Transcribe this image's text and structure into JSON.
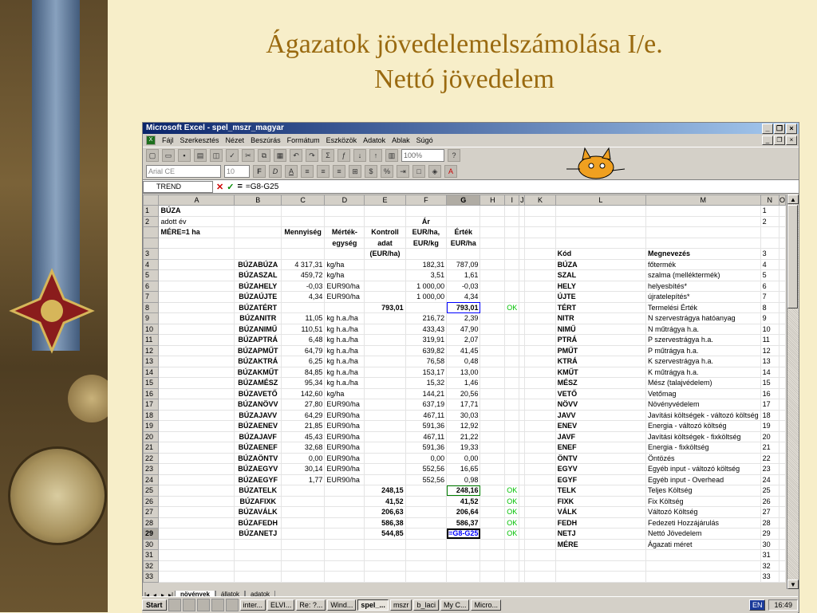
{
  "slide": {
    "title_line1": "Ágazatok jövedelemelszámolása I/e.",
    "title_line2": "Nettó jövedelem"
  },
  "excel": {
    "window_title": "Microsoft Excel - spel_mszr_magyar",
    "menu": [
      "Fájl",
      "Szerkesztés",
      "Nézet",
      "Beszúrás",
      "Formátum",
      "Eszközök",
      "Adatok",
      "Ablak",
      "Súgó"
    ],
    "zoom": "100%",
    "font_name": "Arial CE",
    "font_size": "10",
    "name_box": "TREND",
    "formula": "=G8-G25",
    "columns": [
      "A",
      "B",
      "C",
      "D",
      "E",
      "F",
      "G",
      "H",
      "I",
      "J",
      "K",
      "L",
      "M",
      "N",
      "O"
    ],
    "rows": [
      {
        "n": "1",
        "a": "BÚZA"
      },
      {
        "n": "2",
        "a": "adott év",
        "f": "Ár"
      },
      {
        "n": "",
        "a": "MÉRE=1 ha",
        "c": "Mennyiség",
        "d": "Mérték-",
        "e": "Kontroll",
        "f": "EUR/ha,",
        "g": "Érték"
      },
      {
        "n": "",
        "d": "egység",
        "e": "adat",
        "f": "EUR/kg",
        "g": "EUR/ha"
      },
      {
        "n": "3",
        "e": "(EUR/ha)",
        "l": "Kód",
        "m": "Megnevezés"
      },
      {
        "n": "4",
        "b": "BÚZABÚZA",
        "c": "4 317,31",
        "d": "kg/ha",
        "f": "182,31",
        "g": "787,09",
        "l": "BÚZA",
        "m": "főtermék"
      },
      {
        "n": "5",
        "b": "BÚZASZAL",
        "c": "459,72",
        "d": "kg/ha",
        "f": "3,51",
        "g": "1,61",
        "l": "SZAL",
        "m": "szalma (melléktermék)"
      },
      {
        "n": "6",
        "b": "BÚZAHELY",
        "c": "-0,03",
        "d": "EUR90/ha",
        "f": "1 000,00",
        "g": "-0,03",
        "l": "HELY",
        "m": "helyesbítés*"
      },
      {
        "n": "7",
        "b": "BÚZAÚJTE",
        "c": "4,34",
        "d": "EUR90/ha",
        "f": "1 000,00",
        "g": "4,34",
        "l": "ÚJTE",
        "m": "újratelepítés*"
      },
      {
        "n": "8",
        "b": "BÚZATÉRT",
        "e": "793,01",
        "g": "793,01",
        "i": "OK",
        "l": "TÉRT",
        "m": "Termelési Érték"
      },
      {
        "n": "9",
        "b": "BÚZANITR",
        "c": "11,05",
        "d": "kg h.a./ha",
        "f": "216,72",
        "g": "2,39",
        "l": "NITR",
        "m": "N szervestrágya hatóanyag"
      },
      {
        "n": "10",
        "b": "BÚZANIMŰ",
        "c": "110,51",
        "d": "kg h.a./ha",
        "f": "433,43",
        "g": "47,90",
        "l": "NIMŰ",
        "m": "N műtrágya h.a."
      },
      {
        "n": "11",
        "b": "BÚZAPTRÁ",
        "c": "6,48",
        "d": "kg h.a./ha",
        "f": "319,91",
        "g": "2,07",
        "l": "PTRÁ",
        "m": "P szervestrágya h.a."
      },
      {
        "n": "12",
        "b": "BÚZAPMŰT",
        "c": "64,79",
        "d": "kg h.a./ha",
        "f": "639,82",
        "g": "41,45",
        "l": "PMŰT",
        "m": "P műtrágya h.a."
      },
      {
        "n": "13",
        "b": "BÚZAKTRÁ",
        "c": "6,25",
        "d": "kg h.a./ha",
        "f": "76,58",
        "g": "0,48",
        "l": "KTRÁ",
        "m": "K szervestrágya h.a."
      },
      {
        "n": "14",
        "b": "BÚZAKMŰT",
        "c": "84,85",
        "d": "kg h.a./ha",
        "f": "153,17",
        "g": "13,00",
        "l": "KMŰT",
        "m": "K műtrágya h.a."
      },
      {
        "n": "15",
        "b": "BÚZAMÉSZ",
        "c": "95,34",
        "d": "kg h.a./ha",
        "f": "15,32",
        "g": "1,46",
        "l": "MÉSZ",
        "m": "Mész (talajvédelem)"
      },
      {
        "n": "16",
        "b": "BÚZAVETŐ",
        "c": "142,60",
        "d": "kg/ha",
        "f": "144,21",
        "g": "20,56",
        "l": "VETŐ",
        "m": "Vetőmag"
      },
      {
        "n": "17",
        "b": "BÚZANÖVV",
        "c": "27,80",
        "d": "EUR90/ha",
        "f": "637,19",
        "g": "17,71",
        "l": "NÖVV",
        "m": "Növényvédelem"
      },
      {
        "n": "18",
        "b": "BÚZAJAVV",
        "c": "64,29",
        "d": "EUR90/ha",
        "f": "467,11",
        "g": "30,03",
        "l": "JAVV",
        "m": "Javítási költségek - változó költség"
      },
      {
        "n": "19",
        "b": "BÚZAENEV",
        "c": "21,85",
        "d": "EUR90/ha",
        "f": "591,36",
        "g": "12,92",
        "l": "ENEV",
        "m": "Energia - változó költség"
      },
      {
        "n": "20",
        "b": "BÚZAJAVF",
        "c": "45,43",
        "d": "EUR90/ha",
        "f": "467,11",
        "g": "21,22",
        "l": "JAVF",
        "m": "Javítási költségek - fixköltség"
      },
      {
        "n": "21",
        "b": "BÚZAENEF",
        "c": "32,68",
        "d": "EUR90/ha",
        "f": "591,36",
        "g": "19,33",
        "l": "ENEF",
        "m": "Energia - fixköltség"
      },
      {
        "n": "22",
        "b": "BÚZAÖNTV",
        "c": "0,00",
        "d": "EUR90/ha",
        "f": "0,00",
        "g": "0,00",
        "l": "ÖNTV",
        "m": "Öntözés"
      },
      {
        "n": "23",
        "b": "BÚZAEGYV",
        "c": "30,14",
        "d": "EUR90/ha",
        "f": "552,56",
        "g": "16,65",
        "l": "EGYV",
        "m": "Egyéb input - változó költség"
      },
      {
        "n": "24",
        "b": "BÚZAEGYF",
        "c": "1,77",
        "d": "EUR90/ha",
        "f": "552,56",
        "g": "0,98",
        "l": "EGYF",
        "m": "Egyéb input - Overhead"
      },
      {
        "n": "25",
        "b": "BÚZATELK",
        "e": "248,15",
        "g": "248,16",
        "i": "OK",
        "l": "TELK",
        "m": "Teljes Költség"
      },
      {
        "n": "26",
        "b": "BÚZAFIXK",
        "e": "41,52",
        "g": "41,52",
        "i": "OK",
        "l": "FIXK",
        "m": "Fix Költség"
      },
      {
        "n": "27",
        "b": "BÚZAVÁLK",
        "e": "206,63",
        "g": "206,64",
        "i": "OK",
        "l": "VÁLK",
        "m": "Változó Költség"
      },
      {
        "n": "28",
        "b": "BÚZAFEDH",
        "e": "586,38",
        "g": "586,37",
        "i": "OK",
        "l": "FEDH",
        "m": "Fedezeti Hozzájárulás"
      },
      {
        "n": "29",
        "b": "BÚZANETJ",
        "e": "544,85",
        "g": "=G8-G25",
        "i": "OK",
        "l": "NETJ",
        "m": "Nettó Jövedelem"
      },
      {
        "n": "30",
        "l": "MÉRE",
        "m": "Ágazati méret"
      },
      {
        "n": "31"
      },
      {
        "n": "32"
      },
      {
        "n": "33"
      }
    ],
    "sheet_tabs": [
      "növények",
      "állatok",
      "adatok"
    ]
  },
  "taskbar": {
    "start": "Start",
    "buttons": [
      "inter...",
      "ELVI...",
      "Re: ?...",
      "Wind...",
      "spel_...",
      "mszr",
      "b_laci",
      "My C...",
      "Micro..."
    ],
    "active_index": 4,
    "tray_lang": "EN",
    "clock": "16:49"
  },
  "colors": {
    "title": "#9a6a10",
    "ok": "#00c000",
    "excel_titlebar": "#0a246a"
  }
}
